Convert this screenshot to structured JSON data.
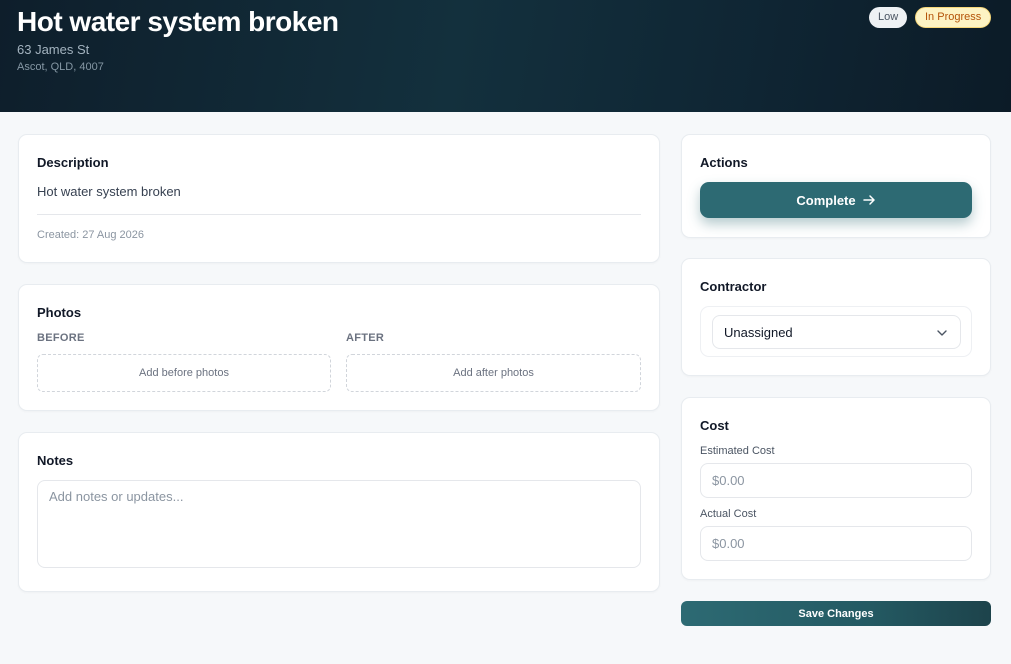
{
  "header": {
    "title": "Hot water system broken",
    "street": "63 James St",
    "city": "Ascot, QLD, 4007",
    "priority_badge": "Low",
    "status_badge": "In Progress"
  },
  "description": {
    "title": "Description",
    "text": "Hot water system broken",
    "created": "Created: 27 Aug 2026"
  },
  "photos": {
    "title": "Photos",
    "before_label": "BEFORE",
    "after_label": "AFTER",
    "before_cta": "Add before photos",
    "after_cta": "Add after photos"
  },
  "notes": {
    "title": "Notes",
    "placeholder": "Add notes or updates..."
  },
  "actions": {
    "title": "Actions",
    "complete_label": "Complete",
    "complete_icon": "arrow-right-icon"
  },
  "contractor": {
    "title": "Contractor",
    "selected": "Unassigned"
  },
  "cost": {
    "title": "Cost",
    "estimated_label": "Estimated Cost",
    "estimated_placeholder": "$0.00",
    "actual_label": "Actual Cost",
    "actual_placeholder": "$0.00"
  },
  "footer": {
    "save_label": "Save Changes"
  },
  "colors": {
    "accent": "#2d6a73",
    "header_bg": "#0f2533",
    "status_bg": "#fdf3c4",
    "status_text": "#b45309"
  }
}
